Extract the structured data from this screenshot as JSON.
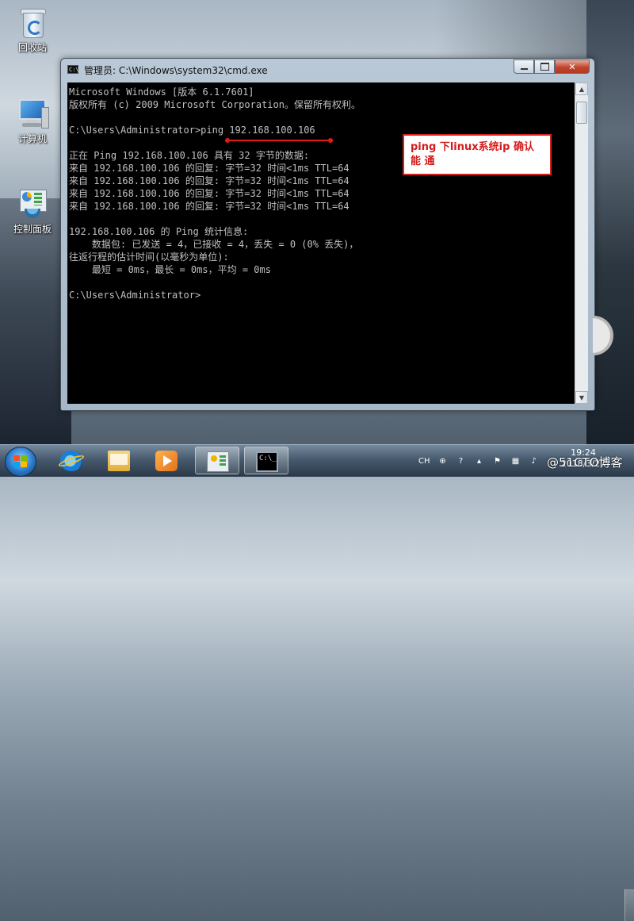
{
  "desktop": {
    "icons": [
      {
        "label": "回收站",
        "icon": "recycle-bin-icon"
      },
      {
        "label": "计算机",
        "icon": "computer-icon"
      },
      {
        "label": "控制面板",
        "icon": "control-panel-icon"
      }
    ]
  },
  "window": {
    "title": "管理员: C:\\Windows\\system32\\cmd.exe",
    "icon_text": "C:\\",
    "buttons": {
      "minimize": "minimize-icon",
      "maximize": "maximize-icon",
      "close": "✕"
    }
  },
  "console": {
    "lines": [
      "Microsoft Windows [版本 6.1.7601]",
      "版权所有 (c) 2009 Microsoft Corporation。保留所有权利。",
      "",
      "C:\\Users\\Administrator>ping 192.168.100.106",
      "",
      "正在 Ping 192.168.100.106 具有 32 字节的数据:",
      "来自 192.168.100.106 的回复: 字节=32 时间<1ms TTL=64",
      "来自 192.168.100.106 的回复: 字节=32 时间<1ms TTL=64",
      "来自 192.168.100.106 的回复: 字节=32 时间<1ms TTL=64",
      "来自 192.168.100.106 的回复: 字节=32 时间<1ms TTL=64",
      "",
      "192.168.100.106 的 Ping 统计信息:",
      "    数据包: 已发送 = 4，已接收 = 4，丢失 = 0 (0% 丢失)，",
      "往返行程的估计时间(以毫秒为单位):",
      "    最短 = 0ms，最长 = 0ms，平均 = 0ms",
      "",
      "C:\\Users\\Administrator>"
    ]
  },
  "annotation": {
    "text": "ping 下linux系统ip 确认能 通",
    "color": "#d41c1c"
  },
  "taskbar": {
    "buttons": [
      {
        "name": "internet-explorer",
        "icon": "ie-icon"
      },
      {
        "name": "windows-explorer",
        "icon": "folder-icon"
      },
      {
        "name": "media-player",
        "icon": "media-player-icon"
      },
      {
        "name": "control-panel",
        "icon": "control-panel-icon"
      },
      {
        "name": "cmd",
        "icon": "cmd-icon",
        "icon_text": "C:\\_"
      }
    ],
    "tray": {
      "language": "CH"
    },
    "clock": {
      "time": "19:24",
      "date": "2018/3/27"
    }
  },
  "watermark": "@51CTO博客"
}
